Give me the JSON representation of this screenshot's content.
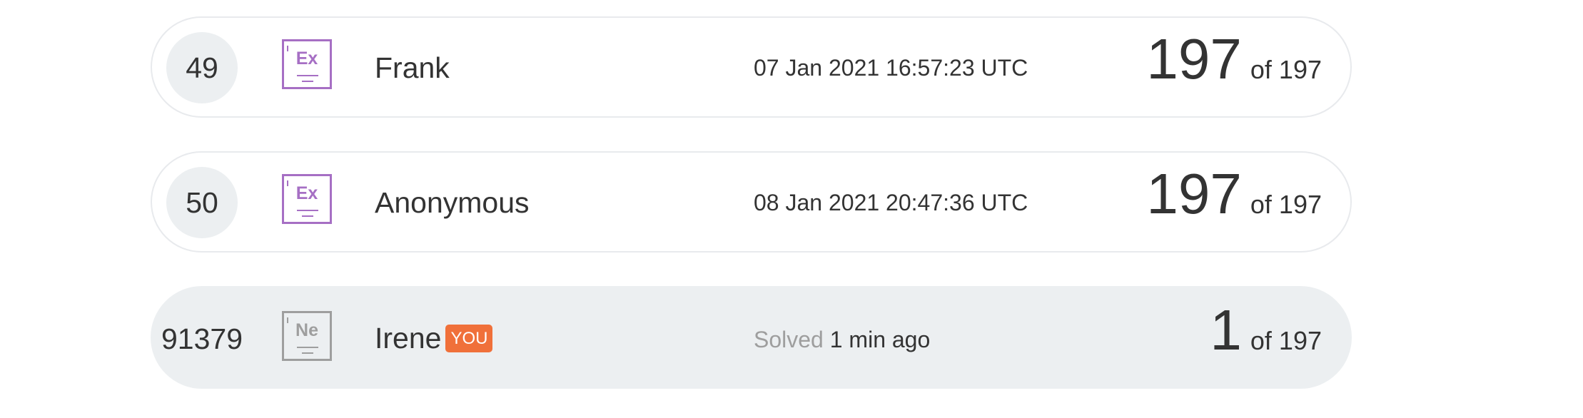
{
  "leaderboard": {
    "rows": [
      {
        "rank": "49",
        "level_icon": "Ex",
        "name": "Frank",
        "time_label": "",
        "time_value": "07 Jan 2021 16:57:23 UTC",
        "score": "197",
        "of_total": "of 197",
        "badge": ""
      },
      {
        "rank": "50",
        "level_icon": "Ex",
        "name": "Anonymous",
        "time_label": "",
        "time_value": "08 Jan 2021 20:47:36 UTC",
        "score": "197",
        "of_total": "of 197",
        "badge": ""
      },
      {
        "rank": "91379",
        "level_icon": "Ne",
        "name": "Irene",
        "badge": "YOU",
        "time_label": "Solved",
        "time_value": "1 min ago",
        "score": "1",
        "of_total": "of 197"
      }
    ]
  },
  "colors": {
    "expert_icon": "#a66fc4",
    "newbie_icon": "#9e9e9e",
    "you_badge": "#f0703a",
    "current_user_row": "#eceff1",
    "row_border": "#e8eaed"
  }
}
